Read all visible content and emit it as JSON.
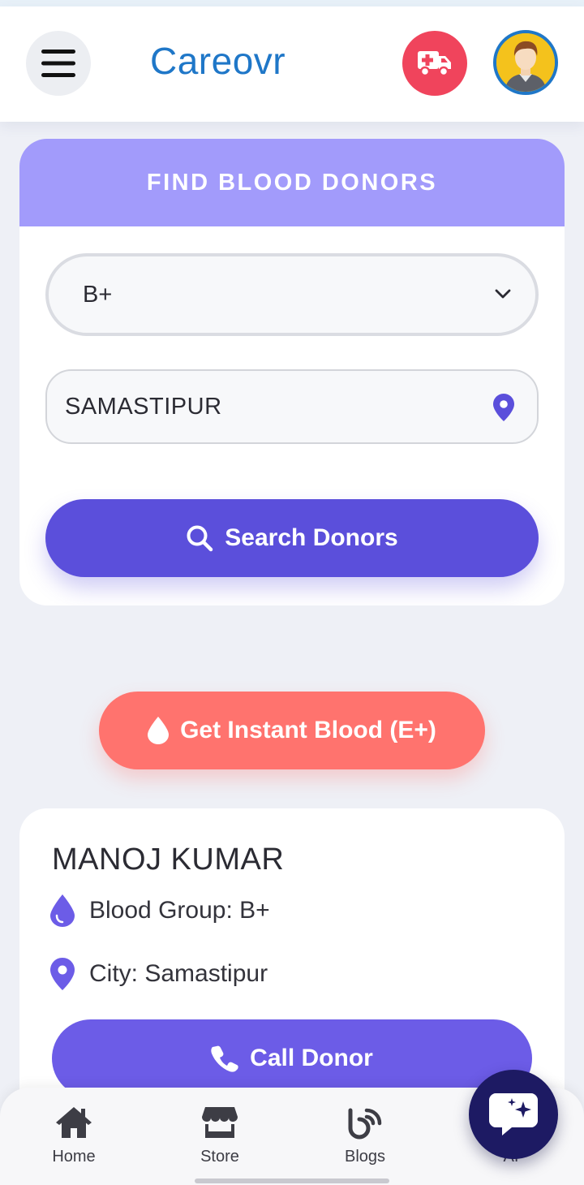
{
  "header": {
    "brand": "Careovr",
    "menu_icon": "hamburger-menu-icon",
    "ambulance_icon": "ambulance-icon",
    "avatar_icon": "user-avatar"
  },
  "search": {
    "title": "FIND BLOOD DONORS",
    "blood_group_value": "B+",
    "city_value": "SAMASTIPUR",
    "search_button": "Search Donors"
  },
  "instant": {
    "label": "Get Instant Blood (E+)"
  },
  "donor": {
    "name": "MANOJ KUMAR",
    "blood_group": "Blood Group: B+",
    "city": "City: Samastipur",
    "call_button": "Call Donor"
  },
  "nav": {
    "items": [
      {
        "label": "Home",
        "icon": "home-icon"
      },
      {
        "label": "Store",
        "icon": "store-icon"
      },
      {
        "label": "Blogs",
        "icon": "blogs-icon"
      },
      {
        "label": "AI",
        "icon": "ai-icon"
      }
    ]
  },
  "colors": {
    "brand": "#1f77c8",
    "header_band": "#a29bfb",
    "primary_button": "#5b4fdb",
    "instant_button": "#ff736e",
    "ambulance": "#f0445c",
    "chat_fab": "#1d1a63"
  }
}
